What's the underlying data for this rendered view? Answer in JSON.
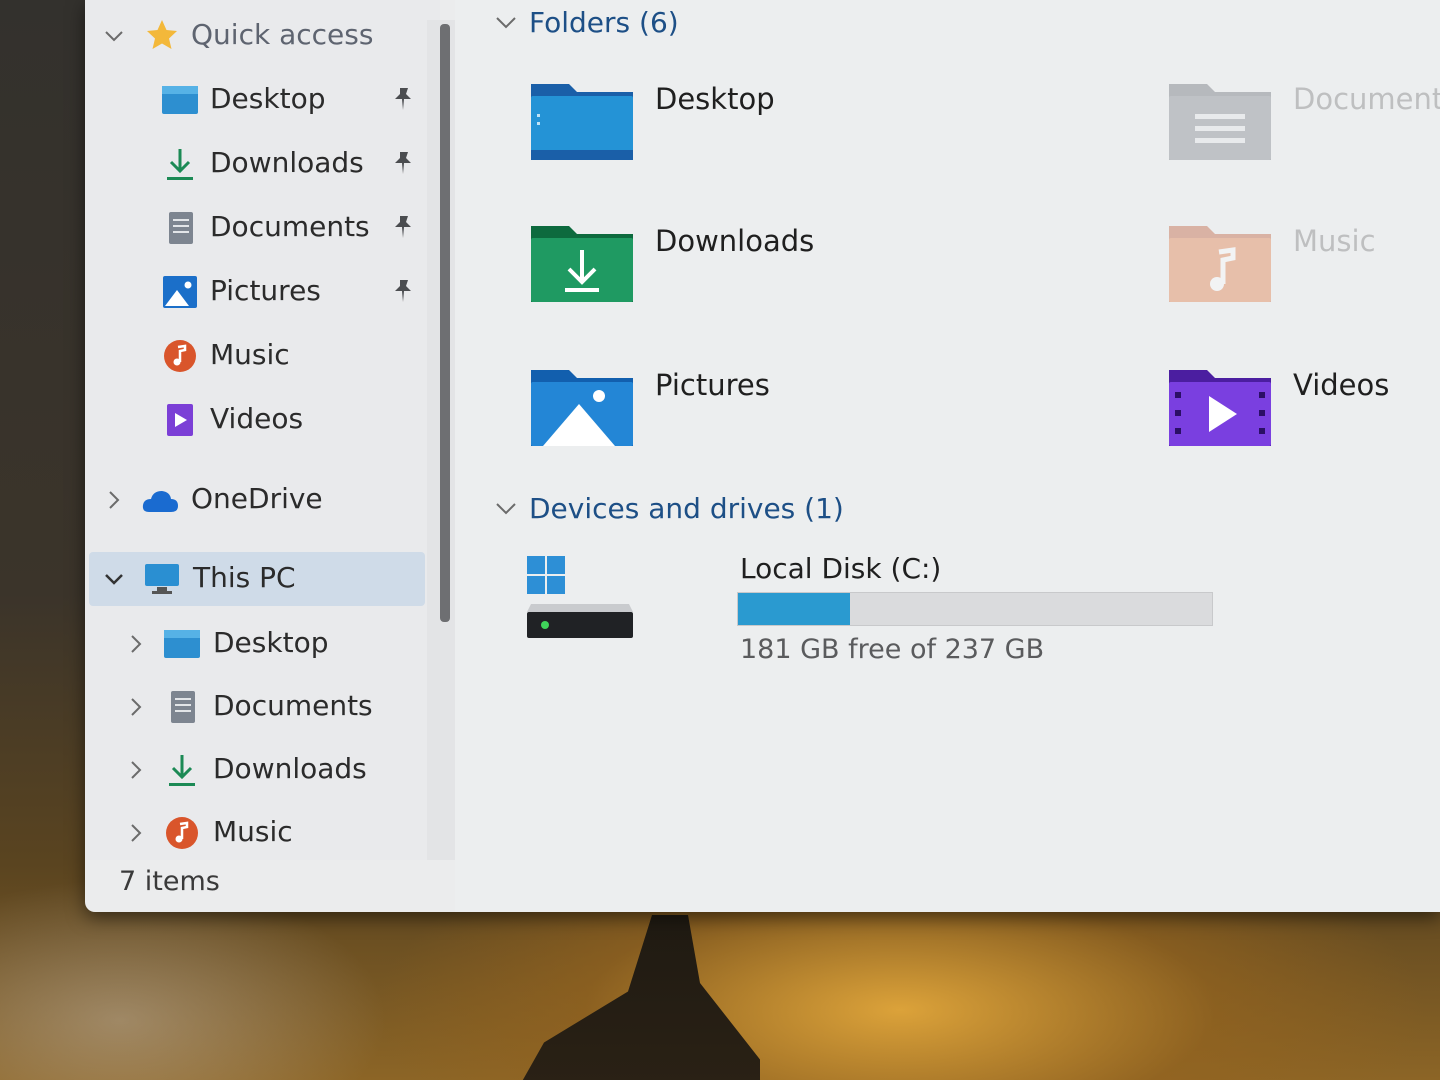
{
  "navigation": {
    "quick_access": {
      "label": "Quick access",
      "items": [
        {
          "label": "Desktop",
          "pinned": true
        },
        {
          "label": "Downloads",
          "pinned": true
        },
        {
          "label": "Documents",
          "pinned": true
        },
        {
          "label": "Pictures",
          "pinned": true
        },
        {
          "label": "Music",
          "pinned": false
        },
        {
          "label": "Videos",
          "pinned": false
        }
      ]
    },
    "onedrive": {
      "label": "OneDrive"
    },
    "this_pc": {
      "label": "This PC",
      "items": [
        {
          "label": "Desktop"
        },
        {
          "label": "Documents"
        },
        {
          "label": "Downloads"
        },
        {
          "label": "Music"
        }
      ]
    }
  },
  "status_bar": {
    "items_count": "7 items"
  },
  "content": {
    "folders_header": "Folders (6)",
    "folders": [
      {
        "name": "Desktop",
        "icon": "desktop-folder-icon"
      },
      {
        "name": "Documents",
        "icon": "documents-folder-icon"
      },
      {
        "name": "Downloads",
        "icon": "downloads-folder-icon"
      },
      {
        "name": "Music",
        "icon": "music-folder-icon"
      },
      {
        "name": "Pictures",
        "icon": "pictures-folder-icon"
      },
      {
        "name": "Videos",
        "icon": "videos-folder-icon"
      }
    ],
    "devices_header": "Devices and drives (1)",
    "drive": {
      "name": "Local Disk (C:)",
      "free_text": "181 GB free of 237 GB",
      "used_fraction": 0.236
    }
  },
  "colors": {
    "accent_blue": "#1d4f86",
    "selection": "#cfdbe8",
    "drive_bar_fill": "#2a9ad0"
  }
}
